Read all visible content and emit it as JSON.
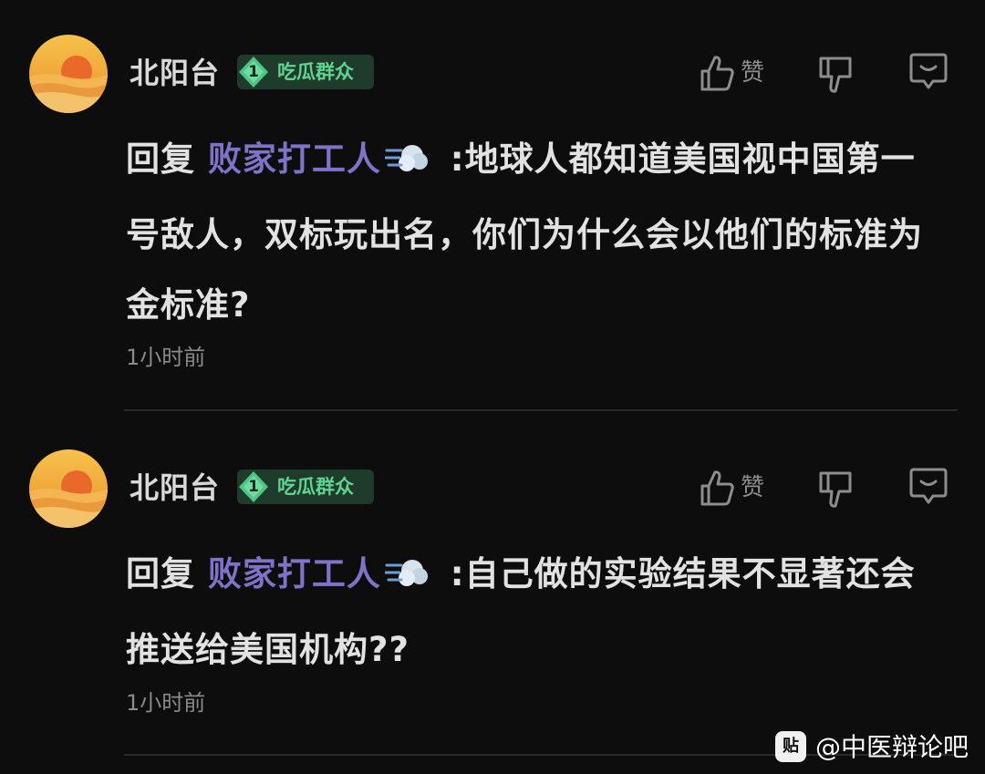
{
  "comments": [
    {
      "username": "北阳台",
      "badge": {
        "level": "1",
        "title": "吃瓜群众"
      },
      "like_label": "赞",
      "reply_prefix": "回复",
      "mention": "败家打工人",
      "emoji": "dash-emoji",
      "text": " :地球人都知道美国视中国第一号敌人，双标玩出名，你们为什么会以他们的标准为金标准?",
      "time": "1小时前"
    },
    {
      "username": "北阳台",
      "badge": {
        "level": "1",
        "title": "吃瓜群众"
      },
      "like_label": "赞",
      "reply_prefix": "回复",
      "mention": "败家打工人",
      "emoji": "dash-emoji",
      "text": " :自己做的实验结果不显著还会推送给美国机构??",
      "time": "1小时前"
    }
  ],
  "watermark": {
    "icon_label": "贴",
    "text": "@中医辩论吧"
  },
  "colors": {
    "background": "#0d0d0e",
    "mention": "#7f73c9",
    "badge_bg": "#1e3b2c",
    "badge_text": "#5fd390",
    "muted": "#8a8a8a"
  }
}
